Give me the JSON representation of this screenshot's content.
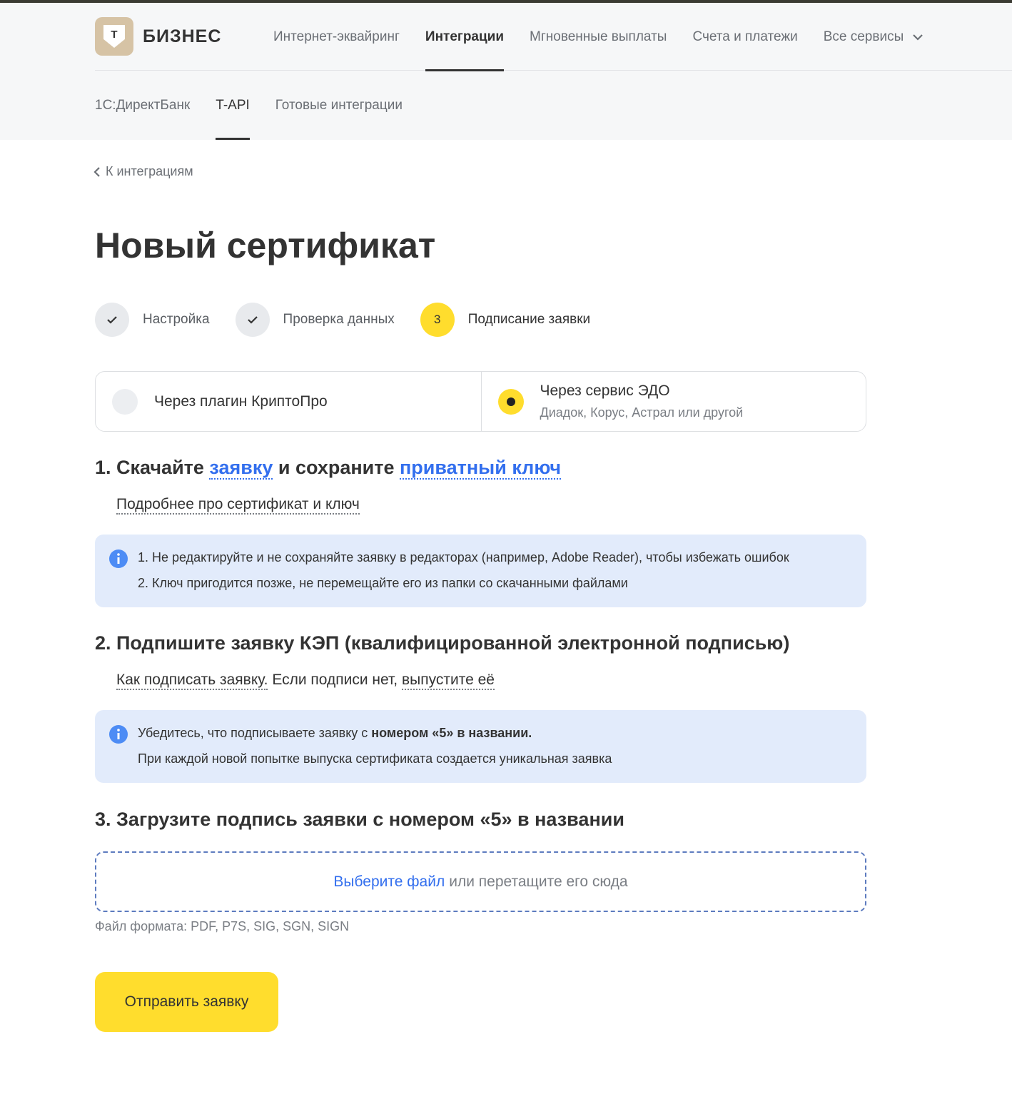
{
  "header": {
    "logo_letter": "Т",
    "logo_text": "БИЗНЕС",
    "nav": [
      "Интернет-эквайринг",
      "Интеграции",
      "Мгновенные выплаты",
      "Счета и платежи",
      "Все сервисы"
    ],
    "subnav": [
      "1С:ДиректБанк",
      "T-API",
      "Готовые интеграции"
    ]
  },
  "back_link": "К интеграциям",
  "page_title": "Новый сертификат",
  "steps": [
    {
      "label": "Настройка",
      "state": "done"
    },
    {
      "label": "Проверка данных",
      "state": "done"
    },
    {
      "label": "Подписание заявки",
      "state": "current",
      "number": "3"
    }
  ],
  "method": {
    "option1_title": "Через плагин КриптоПро",
    "option2_title": "Через сервис ЭДО",
    "option2_sub": "Диадок, Корус, Астрал или другой",
    "selected": "option2"
  },
  "section1": {
    "prefix": "1. Скачайте ",
    "link1": "заявку",
    "middle": " и сохраните ",
    "link2": "приватный ключ",
    "more_link": "Подробнее про сертификат и ключ",
    "note_line1": "1. Не редактируйте и не сохраняйте заявку в редакторах (например, Adobe Reader), чтобы избежать ошибок",
    "note_line2": "2. Ключ пригодится позже, не перемещайте его из папки со скачанными файлами"
  },
  "section2": {
    "heading": "2. Подпишите заявку КЭП (квалифицированной электронной подписью)",
    "link_how": "Как подписать заявку.",
    "text_mid": " Если подписи нет, ",
    "link_issue": "выпустите её",
    "note_line1_a": "Убедитесь, что подписываете заявку с ",
    "note_line1_b": "номером «5» в названии.",
    "note_line2": "При каждой новой попытке выпуска сертификата создается уникальная заявка"
  },
  "section3": {
    "heading": "3. Загрузите подпись заявки с номером «5» в названии",
    "drop_link": "Выберите файл",
    "drop_text": "или перетащите его сюда",
    "hint": "Файл формата: PDF, P7S, SIG, SGN, SIGN"
  },
  "submit_label": "Отправить заявку",
  "colors": {
    "accent": "#ffdd2d",
    "link": "#336fee",
    "note_bg": "#e2ebfb"
  }
}
